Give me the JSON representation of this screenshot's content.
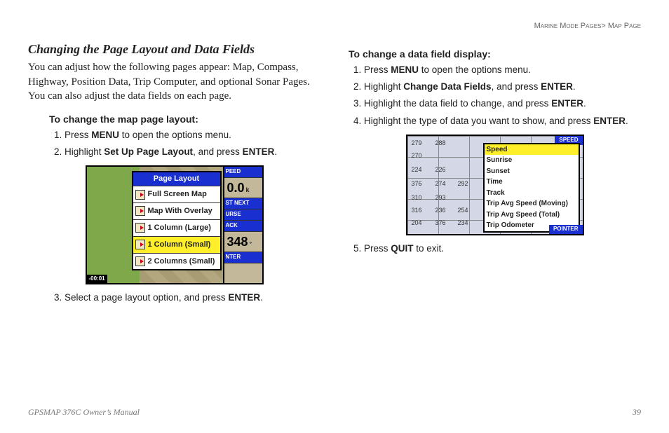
{
  "breadcrumb": {
    "section": "Marine Mode Pages",
    "sep": ">",
    "page": " Map Page"
  },
  "left": {
    "title": "Changing the Page Layout and Data Fields",
    "intro": "You can adjust how the following pages appear: Map, Compass, Highway, Position Data, Trip Computer, and optional Sonar Pages. You can also adjust the data fields on each page.",
    "h3": "To change the map page layout:",
    "s1a": "Press ",
    "s1b": "MENU",
    "s1c": " to open the options menu.",
    "s2a": "Highlight ",
    "s2b": "Set Up Page Layout",
    "s2c": ", and press ",
    "s2d": "ENTER",
    "s2e": ".",
    "s3a": "Select a page layout option, and press ",
    "s3b": "ENTER",
    "s3c": ".",
    "fig": {
      "menu_title": "Page Layout",
      "items": [
        "Full Screen Map",
        "Map With Overlay",
        "1 Column (Large)",
        "1 Column (Small)",
        "2 Columns (Small)"
      ],
      "right": {
        "hdr1": "PEED",
        "val1": "0.0",
        "u1": "k",
        "hdr2": "ST NEXT",
        "hdr3": "URSE",
        "hdr4": "ACK",
        "big": "348",
        "deg": "°",
        "hdr5": "NTER"
      },
      "bottom": "-00:01"
    }
  },
  "right": {
    "h3": "To change a data field display:",
    "s1a": "Press ",
    "s1b": "MENU",
    "s1c": " to open the options menu.",
    "s2a": "Highlight ",
    "s2b": "Change Data Fields",
    "s2c": ", and press ",
    "s2d": "ENTER",
    "s2e": ".",
    "s3a": "Highlight the data field to change, and press ",
    "s3b": "ENTER",
    "s3c": ".",
    "s4a": "Highlight the type of data you want to show, and press ",
    "s4b": "ENTER",
    "s4c": ".",
    "s5a": "Press ",
    "s5b": "QUIT",
    "s5c": " to exit.",
    "fig": {
      "corner": "SPEED",
      "items": [
        "Speed",
        "Sunrise",
        "Sunset",
        "Time",
        "Track",
        "Trip Avg Speed (Moving)",
        "Trip Avg Speed (Total)",
        "Trip Odometer"
      ],
      "nums": [
        "279",
        "288",
        "270",
        "224",
        "226",
        "376",
        "274",
        "292",
        "310",
        "293",
        "316",
        "236",
        "254",
        "204",
        "376",
        "234"
      ],
      "ptr": "POINTER"
    }
  },
  "footer": {
    "left": "GPSMAP 376C Owner’s Manual",
    "right": "39"
  }
}
